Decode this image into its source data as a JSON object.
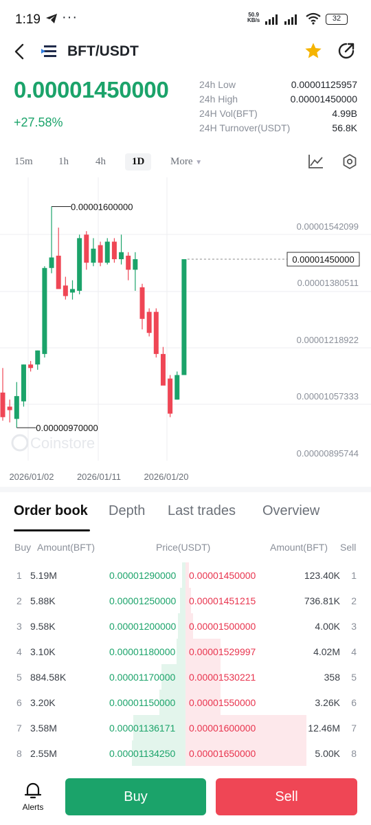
{
  "status": {
    "time": "1:19",
    "dots": "···",
    "net_top": "50.9",
    "net_bottom": "KB/s",
    "battery": "32"
  },
  "header": {
    "pair": "BFT/USDT"
  },
  "ticker": {
    "price": "0.00001450000",
    "change": "+27.58%",
    "stats": [
      {
        "label": "24h Low",
        "value": "0.00001125957"
      },
      {
        "label": "24h High",
        "value": "0.00001450000"
      },
      {
        "label": "24H Vol(BFT)",
        "value": "4.99B"
      },
      {
        "label": "24H Turnover(USDT)",
        "value": "56.8K"
      }
    ]
  },
  "timeframes": {
    "items": [
      "15m",
      "1h",
      "4h",
      "1D",
      "More"
    ],
    "selected": "1D"
  },
  "chart_data": {
    "type": "candlestick",
    "y_ticks": [
      "0.00001542099",
      "0.00001380511",
      "0.00001218922",
      "0.00001057333",
      "0.00000895744"
    ],
    "x_ticks": [
      "2026/01/02",
      "2026/01/11",
      "2026/01/20"
    ],
    "last_price_label": "0.00001450000",
    "high_annotation": "0.00001600000",
    "low_annotation": "0.00000970000",
    "watermark": "Coinstore",
    "colors": {
      "up": "#1ba36a",
      "down": "#ef4655"
    },
    "candles": [
      {
        "o": 1.07,
        "h": 1.14,
        "l": 0.99,
        "c": 1.0
      },
      {
        "o": 1.03,
        "h": 1.05,
        "l": 0.985,
        "c": 1.02
      },
      {
        "o": 0.995,
        "h": 1.1,
        "l": 0.97,
        "c": 1.06
      },
      {
        "o": 1.045,
        "h": 1.15,
        "l": 1.03,
        "c": 1.15
      },
      {
        "o": 1.15,
        "h": 1.16,
        "l": 1.13,
        "c": 1.14
      },
      {
        "o": 1.15,
        "h": 1.19,
        "l": 1.135,
        "c": 1.19
      },
      {
        "o": 1.18,
        "h": 1.43,
        "l": 1.17,
        "c": 1.425
      },
      {
        "o": 1.425,
        "h": 1.6,
        "l": 1.41,
        "c": 1.455
      },
      {
        "o": 1.46,
        "h": 1.54,
        "l": 1.375,
        "c": 1.365
      },
      {
        "o": 1.375,
        "h": 1.4,
        "l": 1.335,
        "c": 1.345
      },
      {
        "o": 1.355,
        "h": 1.39,
        "l": 1.335,
        "c": 1.365
      },
      {
        "o": 1.36,
        "h": 1.52,
        "l": 1.35,
        "c": 1.51
      },
      {
        "o": 1.52,
        "h": 1.53,
        "l": 1.42,
        "c": 1.44
      },
      {
        "o": 1.44,
        "h": 1.51,
        "l": 1.43,
        "c": 1.48
      },
      {
        "o": 1.49,
        "h": 1.5,
        "l": 1.43,
        "c": 1.44
      },
      {
        "o": 1.44,
        "h": 1.51,
        "l": 1.435,
        "c": 1.5
      },
      {
        "o": 1.5,
        "h": 1.51,
        "l": 1.44,
        "c": 1.45
      },
      {
        "o": 1.45,
        "h": 1.52,
        "l": 1.435,
        "c": 1.47
      },
      {
        "o": 1.46,
        "h": 1.47,
        "l": 1.39,
        "c": 1.42
      },
      {
        "o": 1.42,
        "h": 1.47,
        "l": 1.36,
        "c": 1.45
      },
      {
        "o": 1.37,
        "h": 1.38,
        "l": 1.25,
        "c": 1.28
      },
      {
        "o": 1.3,
        "h": 1.31,
        "l": 1.23,
        "c": 1.24
      },
      {
        "o": 1.3,
        "h": 1.31,
        "l": 1.17,
        "c": 1.18
      },
      {
        "o": 1.18,
        "h": 1.2,
        "l": 1.1,
        "c": 1.09
      },
      {
        "o": 1.11,
        "h": 1.12,
        "l": 1.0,
        "c": 1.01
      },
      {
        "o": 1.05,
        "h": 1.13,
        "l": 1.05,
        "c": 1.12
      },
      {
        "o": 1.12,
        "h": 1.45,
        "l": 1.12,
        "c": 1.45
      }
    ]
  },
  "tabs": {
    "items": [
      "Order book",
      "Depth",
      "Last trades",
      "Overview"
    ],
    "active": "Order book"
  },
  "orderbook": {
    "headers": {
      "buy": "Buy",
      "amount_buy": "Amount(BFT)",
      "price": "Price(USDT)",
      "amount_sell": "Amount(BFT)",
      "sell": "Sell"
    },
    "rows": [
      {
        "n": "1",
        "buy_amt": "5.19M",
        "buy_price": "0.00001290000",
        "sell_price": "0.00001450000",
        "sell_amt": "123.40K",
        "buy_depth": 0.02,
        "sell_depth": 0.02
      },
      {
        "n": "2",
        "buy_amt": "5.88K",
        "buy_price": "0.00001250000",
        "sell_price": "0.00001451215",
        "sell_amt": "736.81K",
        "buy_depth": 0.03,
        "sell_depth": 0.03
      },
      {
        "n": "3",
        "buy_amt": "9.58K",
        "buy_price": "0.00001200000",
        "sell_price": "0.00001500000",
        "sell_amt": "4.00K",
        "buy_depth": 0.04,
        "sell_depth": 0.04
      },
      {
        "n": "4",
        "buy_amt": "3.10K",
        "buy_price": "0.00001180000",
        "sell_price": "0.00001529997",
        "sell_amt": "4.02M",
        "buy_depth": 0.05,
        "sell_depth": 0.19
      },
      {
        "n": "5",
        "buy_amt": "884.58K",
        "buy_price": "0.00001170000",
        "sell_price": "0.00001530221",
        "sell_amt": "358",
        "buy_depth": 0.13,
        "sell_depth": 0.19
      },
      {
        "n": "6",
        "buy_amt": "3.20K",
        "buy_price": "0.00001150000",
        "sell_price": "0.00001550000",
        "sell_amt": "3.26K",
        "buy_depth": 0.14,
        "sell_depth": 0.19
      },
      {
        "n": "7",
        "buy_amt": "3.58M",
        "buy_price": "0.00001136171",
        "sell_price": "0.00001600000",
        "sell_amt": "12.46M",
        "buy_depth": 0.28,
        "sell_depth": 0.65
      },
      {
        "n": "8",
        "buy_amt": "2.55M",
        "buy_price": "0.00001134250",
        "sell_price": "0.00001650000",
        "sell_amt": "5.00K",
        "buy_depth": 0.29,
        "sell_depth": 0.65
      }
    ]
  },
  "bottom": {
    "alerts": "Alerts",
    "buy": "Buy",
    "sell": "Sell"
  }
}
